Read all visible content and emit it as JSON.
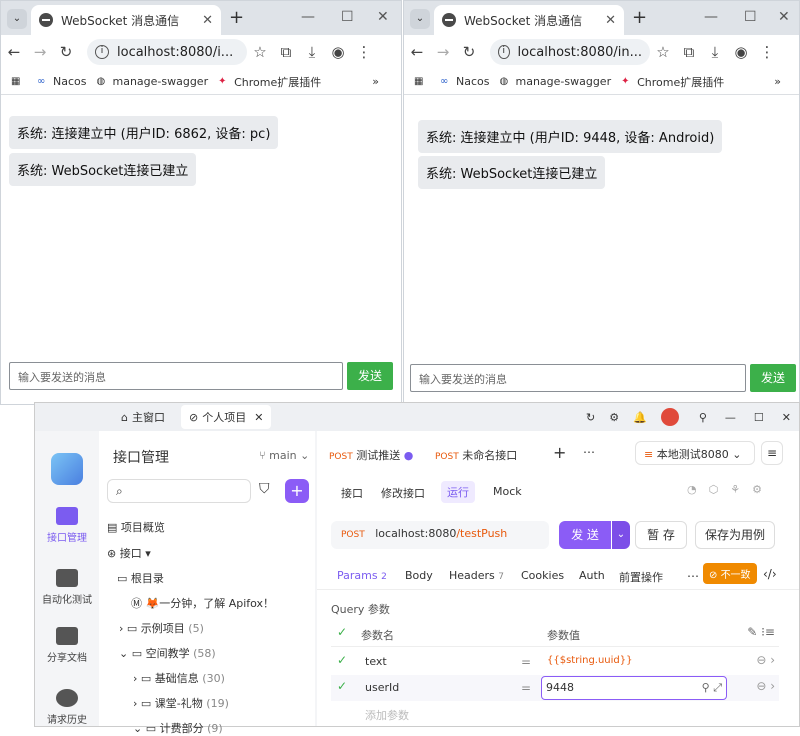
{
  "left_browser": {
    "tab_title": "WebSocket 消息通信",
    "url": "localhost:8080/i...",
    "bookmarks": [
      "Nacos",
      "manage-swagger",
      "Chrome扩展插件"
    ],
    "messages": [
      "系统: 连接建立中 (用户ID: 6862, 设备: pc)",
      "系统: WebSocket连接已建立"
    ],
    "input_placeholder": "输入要发送的消息",
    "send_label": "发送"
  },
  "right_browser": {
    "tab_title": "WebSocket 消息通信",
    "url": "localhost:8080/in...",
    "bookmarks": [
      "Nacos",
      "manage-swagger",
      "Chrome扩展插件"
    ],
    "messages": [
      "系统: 连接建立中 (用户ID: 9448, 设备: Android)",
      "系统: WebSocket连接已建立"
    ],
    "input_placeholder": "输入要发送的消息",
    "send_label": "发送"
  },
  "apifox": {
    "tabs": [
      "主窗口",
      "个人项目"
    ],
    "nav": [
      "接口管理",
      "自动化测试",
      "分享文档",
      "请求历史"
    ],
    "panel_title": "接口管理",
    "branch": "main",
    "tree": {
      "overview": "项目概览",
      "api": "接口",
      "root": "根目录",
      "items": [
        "🦊一分钟，了解 Apifox！",
        "示例项目",
        "空间教学",
        "基础信息",
        "课堂-礼物",
        "计费部分"
      ],
      "counts": [
        "",
        "(5)",
        "(58)",
        "(30)",
        "(19)",
        "(9)"
      ]
    },
    "req_tabs": [
      {
        "method": "POST",
        "name": "测试推送"
      },
      {
        "method": "POST",
        "name": "未命名接口"
      }
    ],
    "env": "本地测试8080",
    "subtabs": [
      "接口",
      "修改接口",
      "运行",
      "Mock"
    ],
    "method": "POST",
    "url_host": "localhost:8080",
    "url_path": "/testPush",
    "send": "发 送",
    "save": "暂 存",
    "save_case": "保存为用例",
    "param_tabs": [
      "Params",
      "Body",
      "Headers",
      "Cookies",
      "Auth",
      "前置操作"
    ],
    "params_count": "2",
    "headers_count": "7",
    "mismatch": "不一致",
    "query_title": "Query 参数",
    "col_name": "参数名",
    "col_value": "参数值",
    "rows": [
      {
        "name": "text",
        "value": "{{$string.uuid}}"
      },
      {
        "name": "userId",
        "value": "9448"
      }
    ],
    "add_param": "添加参数"
  }
}
